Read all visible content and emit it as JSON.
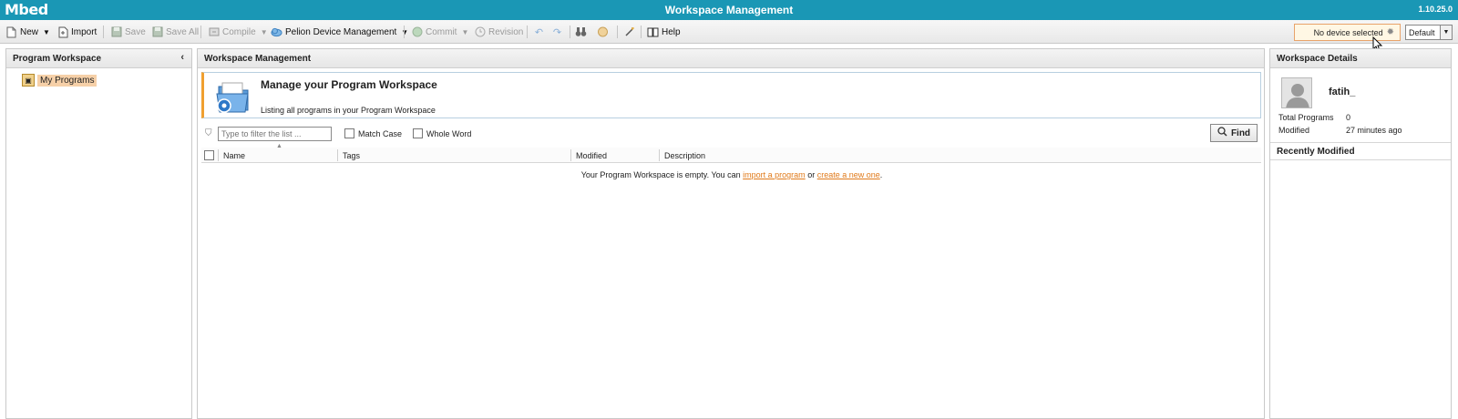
{
  "app": {
    "logo": "Mbed",
    "title": "Workspace Management",
    "version": "1.10.25.0"
  },
  "toolbar": {
    "new_label": "New",
    "import_label": "Import",
    "save_label": "Save",
    "save_all_label": "Save All",
    "compile_label": "Compile",
    "pelion_label": "Pelion Device Management",
    "commit_label": "Commit",
    "revision_label": "Revision",
    "help_label": "Help",
    "device_label": "No device selected",
    "default_label": "Default"
  },
  "left_panel": {
    "title": "Program Workspace",
    "tree_item": "My Programs"
  },
  "center_panel": {
    "title": "Workspace Management",
    "banner_title": "Manage your Program Workspace",
    "banner_subtitle": "Listing all programs in your Program Workspace",
    "filter_placeholder": "Type to filter the list ...",
    "match_case_label": "Match Case",
    "whole_word_label": "Whole Word",
    "find_label": "Find",
    "columns": [
      "Name",
      "Tags",
      "Modified",
      "Description"
    ],
    "empty_prefix": "Your Program Workspace is empty. You can ",
    "empty_link1": "import a program",
    "empty_mid": " or ",
    "empty_link2": "create a new one",
    "empty_suffix": "."
  },
  "right_panel": {
    "title": "Workspace Details",
    "username": "fatih_",
    "total_programs_label": "Total Programs",
    "total_programs_value": "0",
    "modified_label": "Modified",
    "modified_value": "27 minutes ago",
    "recently_modified_label": "Recently Modified"
  },
  "colors": {
    "titlebar": "#1a97b5",
    "link": "#e07a1a",
    "accent_border": "#f0a030",
    "tree_highlight": "#f6d0a8"
  }
}
